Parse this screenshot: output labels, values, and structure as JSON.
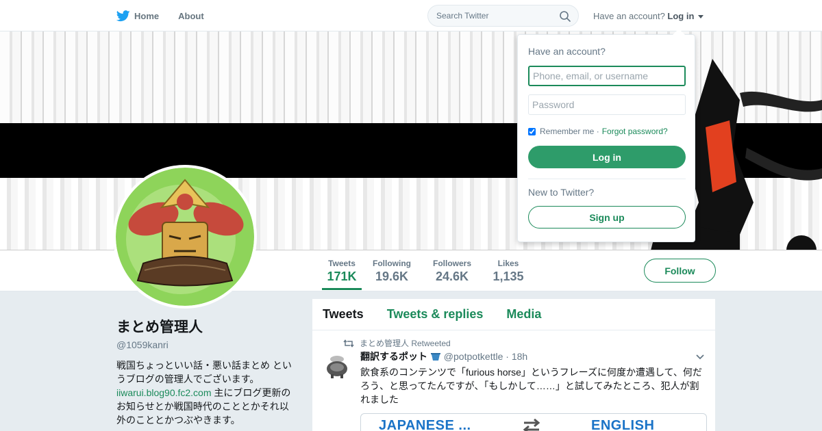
{
  "nav": {
    "home_label": "Home",
    "about_label": "About",
    "search_placeholder": "Search Twitter",
    "account_prompt": "Have an account?",
    "login_label": "Log in"
  },
  "profile": {
    "name": "まとめ管理人",
    "handle": "@1059kanri",
    "bio_part1": "戦国ちょっといい話・悪い話まとめ というブログの管理人でございます。",
    "bio_link": "iiwarui.blog90.fc2.com",
    "bio_part2": " 主にブログ更新のお知らせとか戦国時代のこととかそれ以外のこととかつぶやきます。"
  },
  "stats": [
    {
      "label": "Tweets",
      "value": "171K"
    },
    {
      "label": "Following",
      "value": "19.6K"
    },
    {
      "label": "Followers",
      "value": "24.6K"
    },
    {
      "label": "Likes",
      "value": "1,135"
    }
  ],
  "follow_label": "Follow",
  "timeline": {
    "tabs": [
      "Tweets",
      "Tweets & replies",
      "Media"
    ],
    "tweet": {
      "retweet_note": "まとめ管理人 Retweeted",
      "author_name": "翻訳するポット",
      "author_handle": "@potpotkettle",
      "time": "· 18h",
      "text": "飲食系のコンテンツで「furious horse」というフレーズに何度か遭遇して、何だろう、と思ってたんですが、「もしかして……」と試してみたところ、犯人が割れました",
      "card_left": "JAPANESE ...",
      "card_right": "ENGLISH"
    }
  },
  "login_dropdown": {
    "title": "Have an account?",
    "username_placeholder": "Phone, email, or username",
    "password_placeholder": "Password",
    "remember_label": "Remember me ·",
    "forgot_label": "Forgot password?",
    "login_button": "Log in",
    "new_prompt": "New to Twitter?",
    "signup_button": "Sign up"
  },
  "colors": {
    "accent": "#1b8a5a",
    "twitter_blue": "#1da1f2",
    "background": "#e6ecf0"
  }
}
